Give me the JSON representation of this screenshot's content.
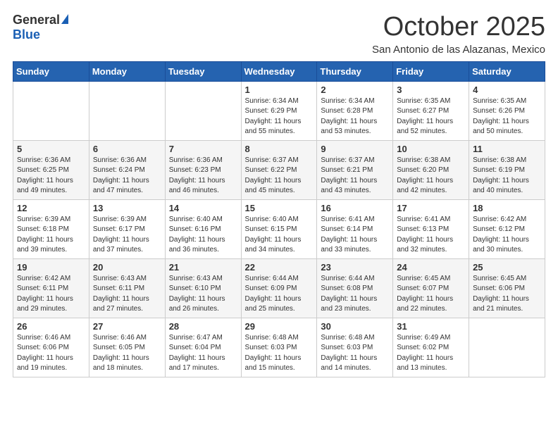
{
  "header": {
    "logo_general": "General",
    "logo_blue": "Blue",
    "month_title": "October 2025",
    "location": "San Antonio de las Alazanas, Mexico"
  },
  "days_of_week": [
    "Sunday",
    "Monday",
    "Tuesday",
    "Wednesday",
    "Thursday",
    "Friday",
    "Saturday"
  ],
  "weeks": [
    [
      {
        "day": "",
        "info": ""
      },
      {
        "day": "",
        "info": ""
      },
      {
        "day": "",
        "info": ""
      },
      {
        "day": "1",
        "info": "Sunrise: 6:34 AM\nSunset: 6:29 PM\nDaylight: 11 hours\nand 55 minutes."
      },
      {
        "day": "2",
        "info": "Sunrise: 6:34 AM\nSunset: 6:28 PM\nDaylight: 11 hours\nand 53 minutes."
      },
      {
        "day": "3",
        "info": "Sunrise: 6:35 AM\nSunset: 6:27 PM\nDaylight: 11 hours\nand 52 minutes."
      },
      {
        "day": "4",
        "info": "Sunrise: 6:35 AM\nSunset: 6:26 PM\nDaylight: 11 hours\nand 50 minutes."
      }
    ],
    [
      {
        "day": "5",
        "info": "Sunrise: 6:36 AM\nSunset: 6:25 PM\nDaylight: 11 hours\nand 49 minutes."
      },
      {
        "day": "6",
        "info": "Sunrise: 6:36 AM\nSunset: 6:24 PM\nDaylight: 11 hours\nand 47 minutes."
      },
      {
        "day": "7",
        "info": "Sunrise: 6:36 AM\nSunset: 6:23 PM\nDaylight: 11 hours\nand 46 minutes."
      },
      {
        "day": "8",
        "info": "Sunrise: 6:37 AM\nSunset: 6:22 PM\nDaylight: 11 hours\nand 45 minutes."
      },
      {
        "day": "9",
        "info": "Sunrise: 6:37 AM\nSunset: 6:21 PM\nDaylight: 11 hours\nand 43 minutes."
      },
      {
        "day": "10",
        "info": "Sunrise: 6:38 AM\nSunset: 6:20 PM\nDaylight: 11 hours\nand 42 minutes."
      },
      {
        "day": "11",
        "info": "Sunrise: 6:38 AM\nSunset: 6:19 PM\nDaylight: 11 hours\nand 40 minutes."
      }
    ],
    [
      {
        "day": "12",
        "info": "Sunrise: 6:39 AM\nSunset: 6:18 PM\nDaylight: 11 hours\nand 39 minutes."
      },
      {
        "day": "13",
        "info": "Sunrise: 6:39 AM\nSunset: 6:17 PM\nDaylight: 11 hours\nand 37 minutes."
      },
      {
        "day": "14",
        "info": "Sunrise: 6:40 AM\nSunset: 6:16 PM\nDaylight: 11 hours\nand 36 minutes."
      },
      {
        "day": "15",
        "info": "Sunrise: 6:40 AM\nSunset: 6:15 PM\nDaylight: 11 hours\nand 34 minutes."
      },
      {
        "day": "16",
        "info": "Sunrise: 6:41 AM\nSunset: 6:14 PM\nDaylight: 11 hours\nand 33 minutes."
      },
      {
        "day": "17",
        "info": "Sunrise: 6:41 AM\nSunset: 6:13 PM\nDaylight: 11 hours\nand 32 minutes."
      },
      {
        "day": "18",
        "info": "Sunrise: 6:42 AM\nSunset: 6:12 PM\nDaylight: 11 hours\nand 30 minutes."
      }
    ],
    [
      {
        "day": "19",
        "info": "Sunrise: 6:42 AM\nSunset: 6:11 PM\nDaylight: 11 hours\nand 29 minutes."
      },
      {
        "day": "20",
        "info": "Sunrise: 6:43 AM\nSunset: 6:11 PM\nDaylight: 11 hours\nand 27 minutes."
      },
      {
        "day": "21",
        "info": "Sunrise: 6:43 AM\nSunset: 6:10 PM\nDaylight: 11 hours\nand 26 minutes."
      },
      {
        "day": "22",
        "info": "Sunrise: 6:44 AM\nSunset: 6:09 PM\nDaylight: 11 hours\nand 25 minutes."
      },
      {
        "day": "23",
        "info": "Sunrise: 6:44 AM\nSunset: 6:08 PM\nDaylight: 11 hours\nand 23 minutes."
      },
      {
        "day": "24",
        "info": "Sunrise: 6:45 AM\nSunset: 6:07 PM\nDaylight: 11 hours\nand 22 minutes."
      },
      {
        "day": "25",
        "info": "Sunrise: 6:45 AM\nSunset: 6:06 PM\nDaylight: 11 hours\nand 21 minutes."
      }
    ],
    [
      {
        "day": "26",
        "info": "Sunrise: 6:46 AM\nSunset: 6:06 PM\nDaylight: 11 hours\nand 19 minutes."
      },
      {
        "day": "27",
        "info": "Sunrise: 6:46 AM\nSunset: 6:05 PM\nDaylight: 11 hours\nand 18 minutes."
      },
      {
        "day": "28",
        "info": "Sunrise: 6:47 AM\nSunset: 6:04 PM\nDaylight: 11 hours\nand 17 minutes."
      },
      {
        "day": "29",
        "info": "Sunrise: 6:48 AM\nSunset: 6:03 PM\nDaylight: 11 hours\nand 15 minutes."
      },
      {
        "day": "30",
        "info": "Sunrise: 6:48 AM\nSunset: 6:03 PM\nDaylight: 11 hours\nand 14 minutes."
      },
      {
        "day": "31",
        "info": "Sunrise: 6:49 AM\nSunset: 6:02 PM\nDaylight: 11 hours\nand 13 minutes."
      },
      {
        "day": "",
        "info": ""
      }
    ]
  ]
}
